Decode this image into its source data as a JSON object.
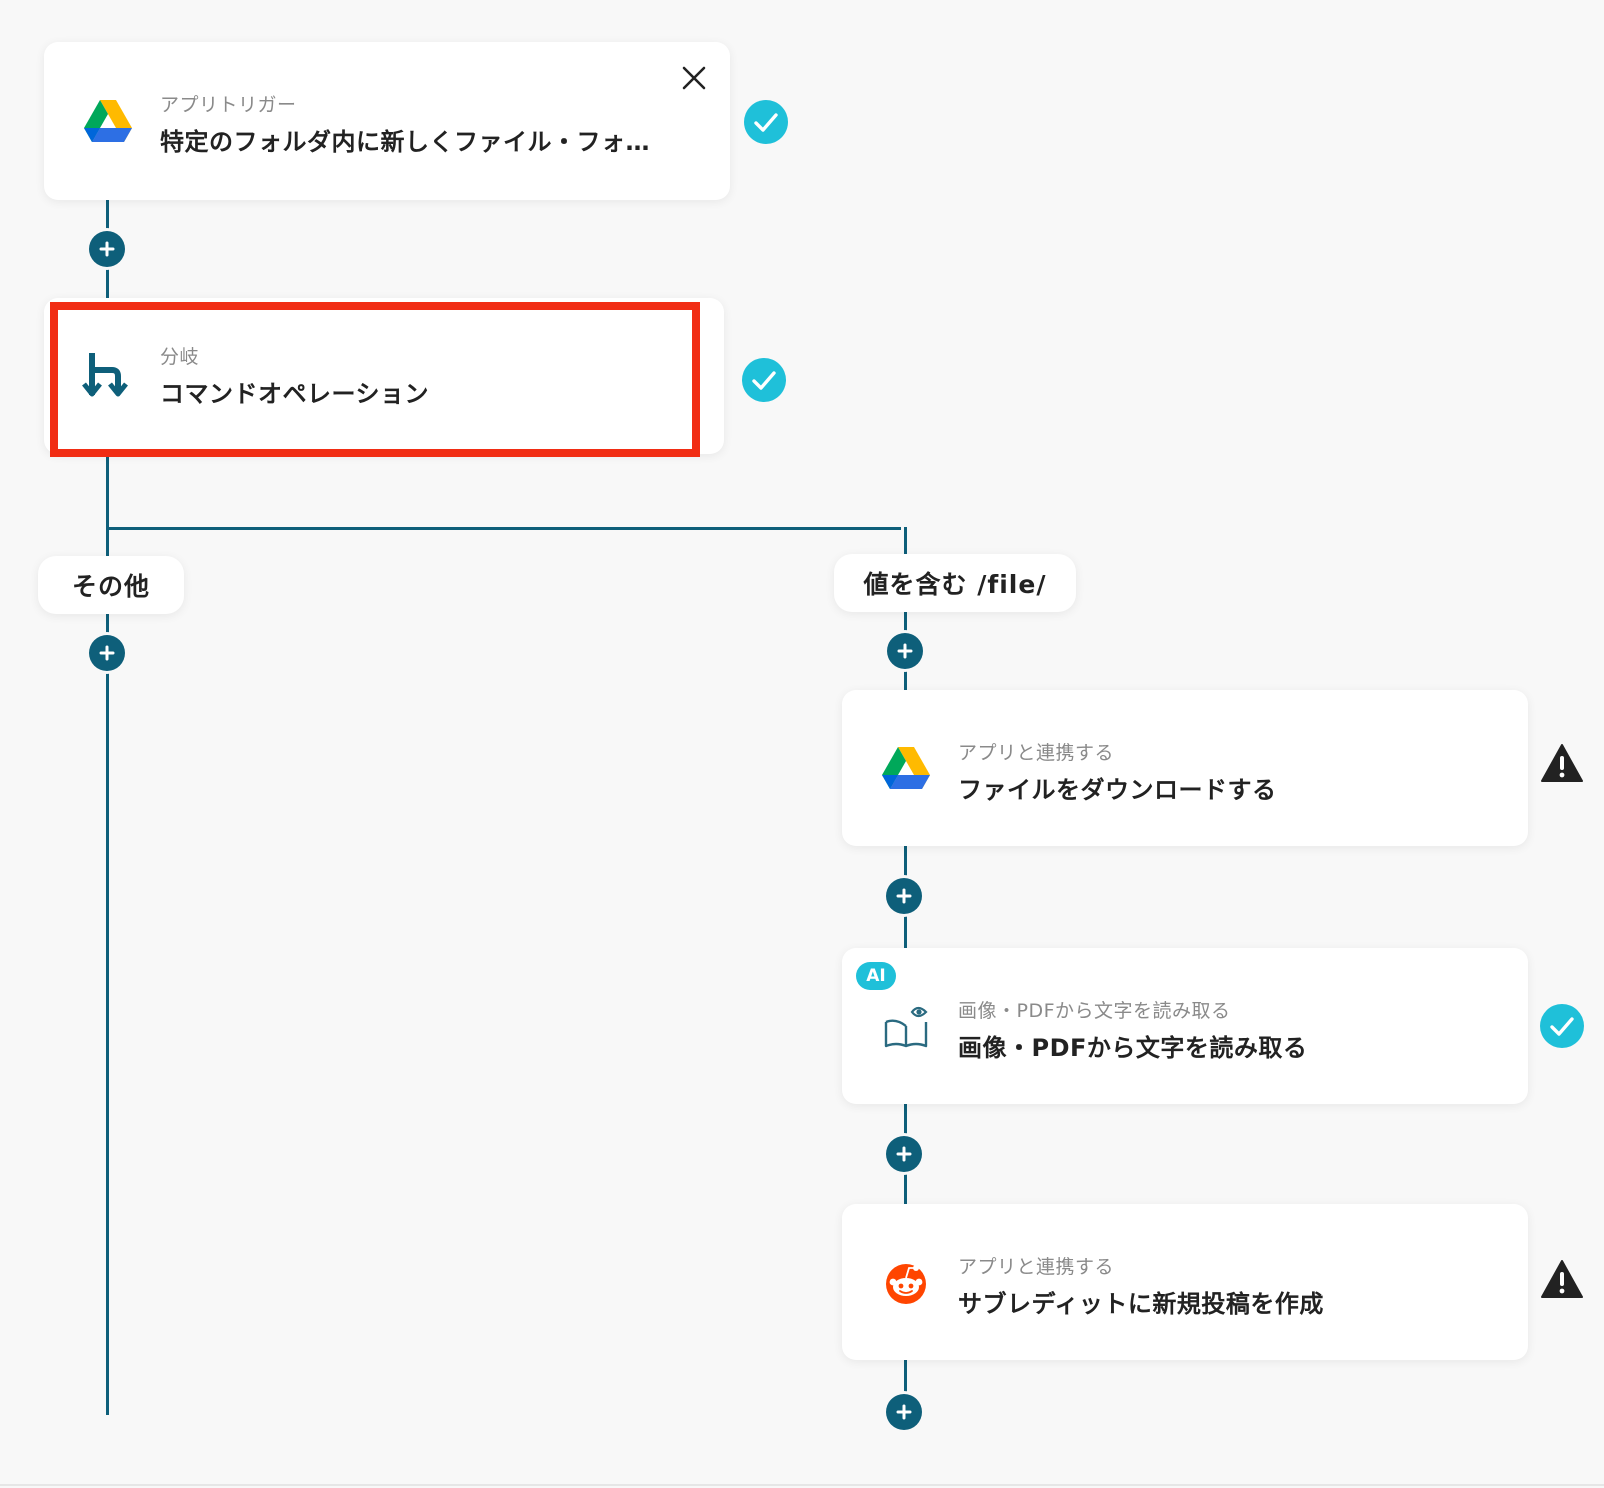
{
  "trigger_card": {
    "subtitle": "アプリトリガー",
    "title": "特定のフォルダ内に新しくファイル・フォ…",
    "icon": "google-drive-icon",
    "status": "complete"
  },
  "branch_card": {
    "subtitle": "分岐",
    "title": "コマンドオペレーション",
    "icon": "branch-icon",
    "status": "complete"
  },
  "branches": {
    "left_label": "その他",
    "right_label": "値を含む /file/"
  },
  "download_card": {
    "subtitle": "アプリと連携する",
    "title": "ファイルをダウンロードする",
    "icon": "google-drive-icon",
    "status": "warning"
  },
  "ocr_card": {
    "badge": "AI",
    "subtitle": "画像・PDFから文字を読み取る",
    "title": "画像・PDFから文字を読み取る",
    "icon": "book-eye-icon",
    "status": "complete"
  },
  "reddit_card": {
    "subtitle": "アプリと連携する",
    "title": "サブレディットに新規投稿を作成",
    "icon": "reddit-icon",
    "status": "warning"
  },
  "colors": {
    "line": "#0e5f7a",
    "check": "#1fc0d9",
    "warning": "#222222",
    "highlight": "#f12d14"
  }
}
